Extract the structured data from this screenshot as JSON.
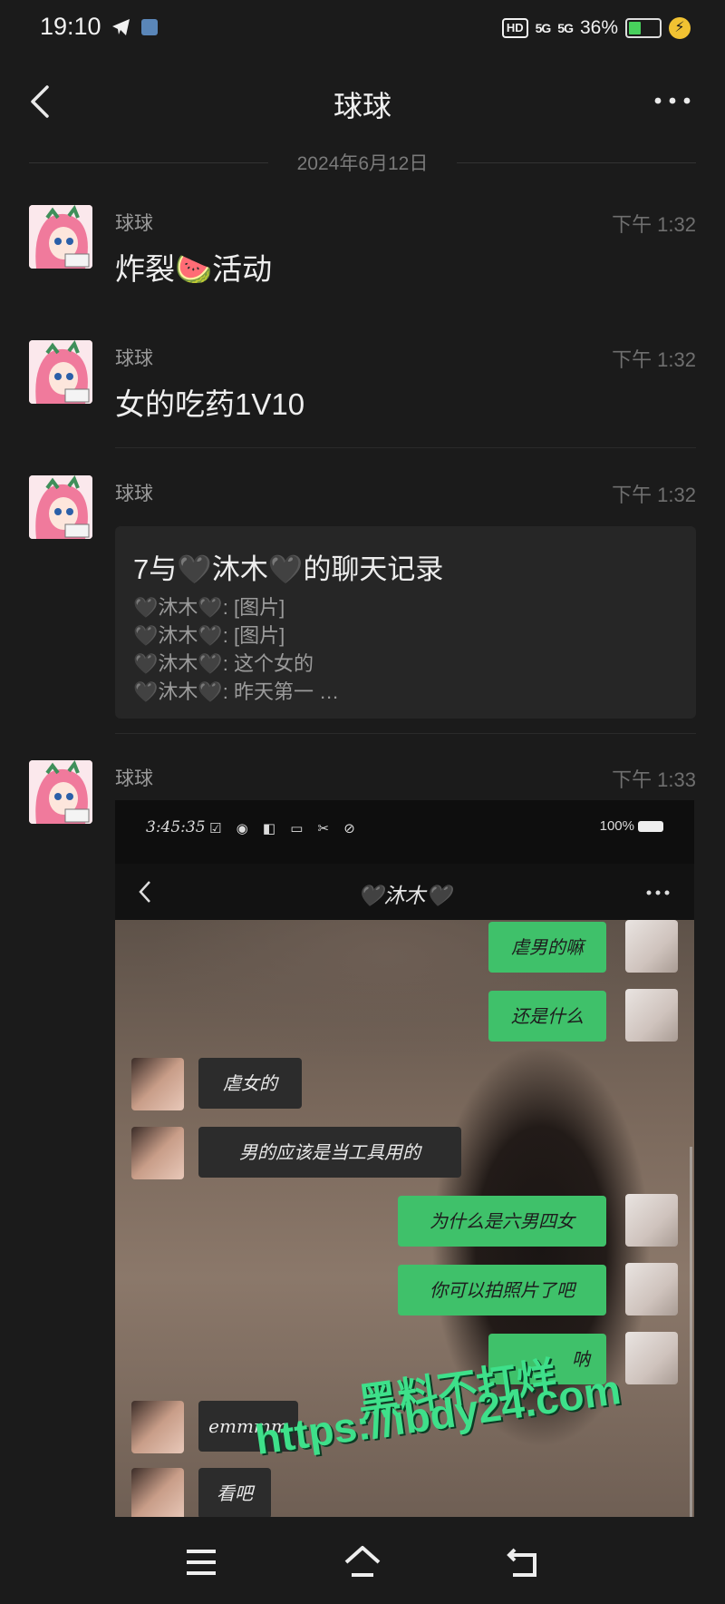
{
  "status_bar": {
    "time": "19:10",
    "network_1": "5G",
    "network_2": "5G",
    "battery": "36%"
  },
  "header": {
    "title": "球球"
  },
  "date_divider": "2024年6月12日",
  "messages": [
    {
      "sender": "球球",
      "time": "下午 1:32",
      "text": "炸裂🍉活动"
    },
    {
      "sender": "球球",
      "time": "下午 1:32",
      "text": "女的吃药1V10"
    },
    {
      "sender": "球球",
      "time": "下午 1:32",
      "card": {
        "title": "7与🖤沐木🖤的聊天记录",
        "lines": [
          "🖤沐木🖤: [图片]",
          "🖤沐木🖤: [图片]",
          "🖤沐木🖤: 这个女的",
          "🖤沐木🖤: 昨天第一 …"
        ]
      }
    },
    {
      "sender": "球球",
      "time": "下午 1:33",
      "screenshot": {
        "status_time": "3:45:35",
        "status_right": "100%",
        "title": "🖤沐木🖤",
        "bubbles": [
          "虐男的嘛",
          "还是什么",
          "虐女的",
          "男的应该是当工具用的",
          "为什么是六男四女",
          "你可以拍照片了吧",
          "呐",
          "emmmm",
          "看吧"
        ]
      }
    }
  ],
  "watermark": {
    "line1": "黑料不打烊",
    "line2": "https://ibdy24.com"
  }
}
